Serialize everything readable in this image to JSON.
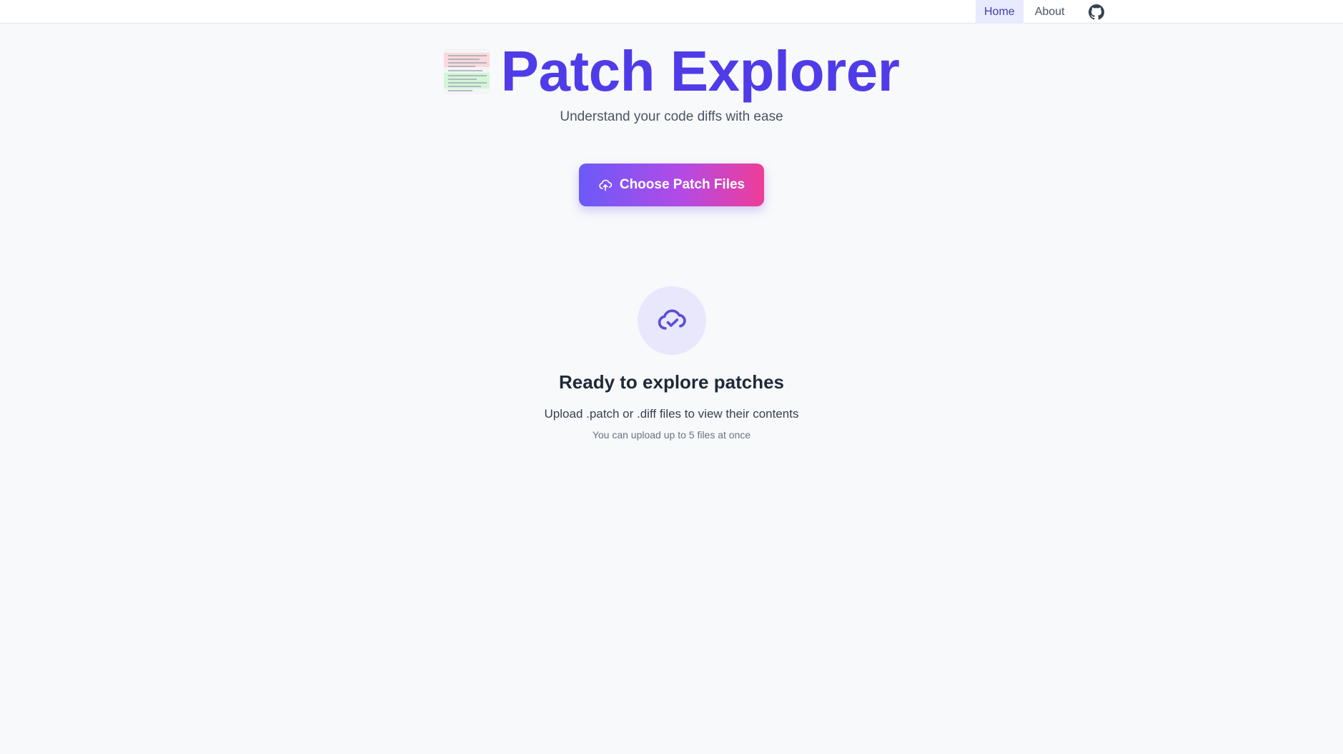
{
  "nav": {
    "items": [
      {
        "label": "Home",
        "active": true
      },
      {
        "label": "About",
        "active": false
      }
    ],
    "github_icon": "github-icon"
  },
  "hero": {
    "logo_icon": "patch-diff-logo",
    "title": "Patch Explorer",
    "subtitle": "Understand your code diffs with ease"
  },
  "upload": {
    "button_label": "Choose Patch Files",
    "button_icon": "cloud-upload-icon"
  },
  "empty_state": {
    "icon": "cloud-check-icon",
    "title": "Ready to explore patches",
    "description": "Upload .patch or .diff files to view their contents",
    "note": "You can upload up to 5 files at once"
  },
  "colors": {
    "accent": "#4f3ce8",
    "gradient_start": "#6a5af9",
    "gradient_end": "#ee3d97",
    "nav_active_bg": "#e8eafd",
    "empty_icon_bg": "#e9e7fb"
  }
}
